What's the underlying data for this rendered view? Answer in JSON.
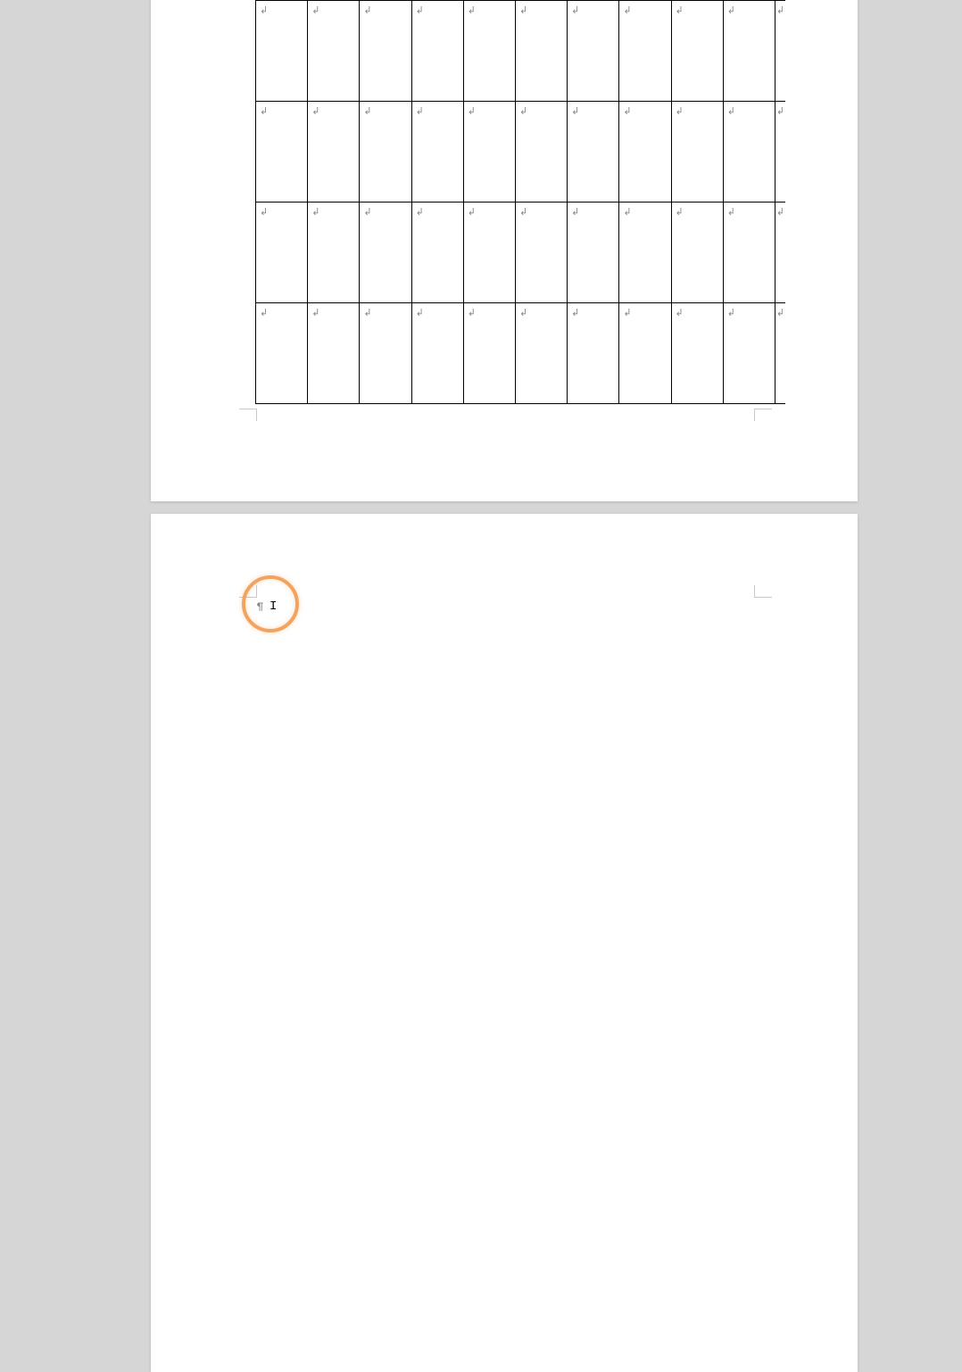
{
  "document": {
    "paragraph_mark": "↲",
    "pilcrow": "¶",
    "table": {
      "rows": 4,
      "cols": 11
    },
    "colors": {
      "page_background": "#d6d6d6",
      "paper": "#ffffff",
      "table_border": "#000000",
      "mark": "#888888",
      "highlight": "#f2a35e"
    }
  }
}
